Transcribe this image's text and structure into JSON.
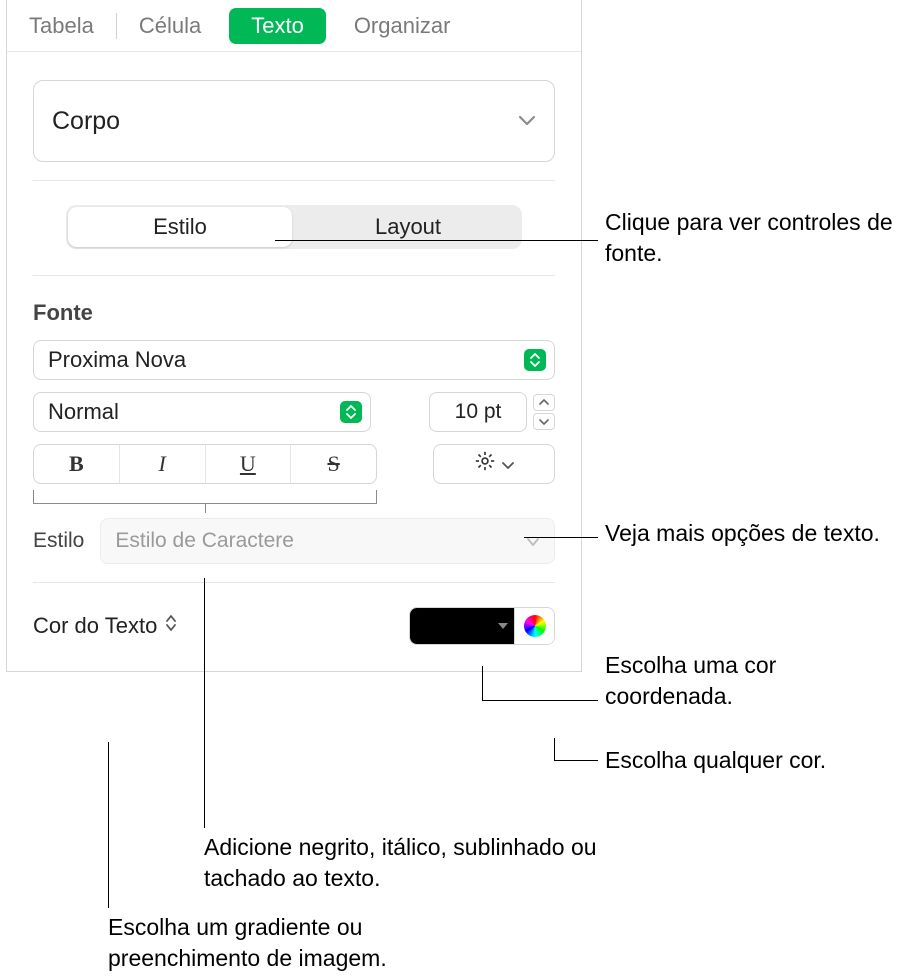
{
  "tabs": {
    "table": "Tabela",
    "cell": "Célula",
    "text": "Texto",
    "organize": "Organizar"
  },
  "paragraphStyle": {
    "value": "Corpo"
  },
  "subtabs": {
    "style": "Estilo",
    "layout": "Layout"
  },
  "font": {
    "label": "Fonte",
    "family": "Proxima Nova",
    "weight": "Normal",
    "size": "10 pt",
    "bold": "B",
    "italic": "I",
    "underline": "U",
    "strike": "S"
  },
  "charStyle": {
    "label": "Estilo",
    "placeholder": "Estilo de Caractere"
  },
  "textColor": {
    "label": "Cor do Texto"
  },
  "callouts": {
    "fontControls": "Clique para ver controles de fonte.",
    "moreText": "Veja mais opções de texto.",
    "coordColor": "Escolha uma cor coordenada.",
    "anyColor": "Escolha qualquer cor.",
    "bius": "Adicione negrito, itálico, sublinhado ou tachado ao texto.",
    "gradient": "Escolha um gradiente ou preenchimento de imagem."
  }
}
